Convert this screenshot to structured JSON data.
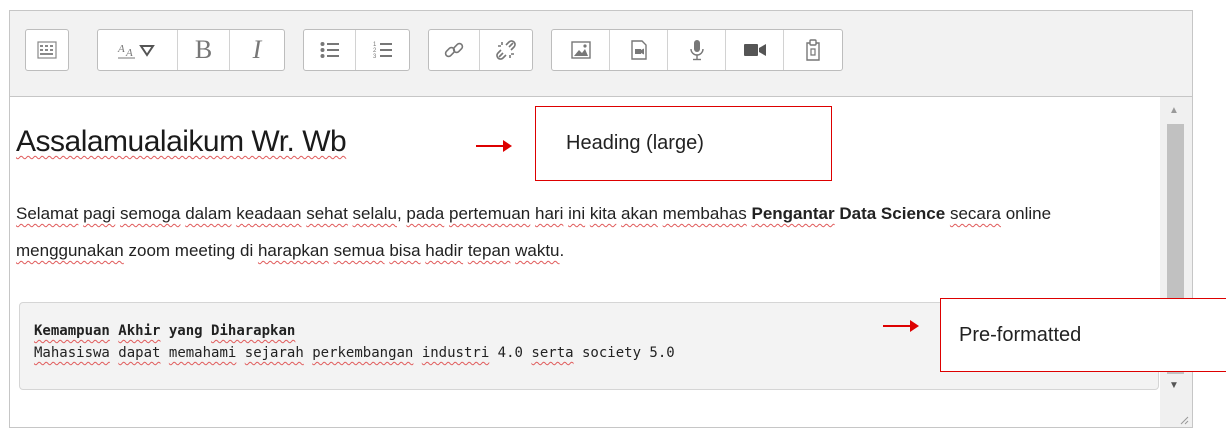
{
  "toolbar": {
    "buttons": [
      "toggle-toolbar",
      "paragraph-styles",
      "bold",
      "italic",
      "unordered-list",
      "ordered-list",
      "link",
      "unlink",
      "insert-image",
      "insert-media",
      "record-audio",
      "record-video",
      "manage-files"
    ],
    "bold_label": "B",
    "italic_label": "I"
  },
  "content": {
    "heading": "Assalamualaikum Wr. Wb",
    "paragraph": [
      {
        "t": "Selamat",
        "u": true
      },
      {
        "t": " "
      },
      {
        "t": "pagi",
        "u": true
      },
      {
        "t": " "
      },
      {
        "t": "semoga",
        "u": true
      },
      {
        "t": " "
      },
      {
        "t": "dalam",
        "u": true
      },
      {
        "t": " "
      },
      {
        "t": "keadaan",
        "u": true
      },
      {
        "t": " "
      },
      {
        "t": "sehat",
        "u": true
      },
      {
        "t": " "
      },
      {
        "t": "selalu",
        "u": true
      },
      {
        "t": ", "
      },
      {
        "t": "pada",
        "u": true
      },
      {
        "t": " "
      },
      {
        "t": "pertemuan",
        "u": true
      },
      {
        "t": " "
      },
      {
        "t": "hari",
        "u": true
      },
      {
        "t": " "
      },
      {
        "t": "ini",
        "u": true
      },
      {
        "t": " "
      },
      {
        "t": "kita",
        "u": true
      },
      {
        "t": " "
      },
      {
        "t": "akan",
        "u": true
      },
      {
        "t": " "
      },
      {
        "t": "membahas",
        "u": true
      },
      {
        "t": " "
      },
      {
        "t": "Pengantar",
        "u": true,
        "b": true
      },
      {
        "t": " Data Science",
        "b": true
      },
      {
        "t": " "
      },
      {
        "t": "secara",
        "u": true
      },
      {
        "t": " online "
      },
      {
        "t": "menggunakan",
        "u": true
      },
      {
        "t": " zoom meeting di "
      },
      {
        "t": "harapkan",
        "u": true
      },
      {
        "t": " "
      },
      {
        "t": "semua",
        "u": true
      },
      {
        "t": " "
      },
      {
        "t": "bisa",
        "u": true
      },
      {
        "t": " "
      },
      {
        "t": "hadir",
        "u": true
      },
      {
        "t": " "
      },
      {
        "t": "tepan",
        "u": true
      },
      {
        "t": " "
      },
      {
        "t": "waktu",
        "u": true
      },
      {
        "t": "."
      }
    ],
    "preformatted": [
      [
        {
          "t": "Kemampuan",
          "u": true,
          "b": true
        },
        {
          "t": " ",
          "b": true
        },
        {
          "t": "Akhir",
          "u": true,
          "b": true
        },
        {
          "t": " yang ",
          "b": true
        },
        {
          "t": "Diharapkan",
          "u": true,
          "b": true
        }
      ],
      [
        {
          "t": "Mahasiswa",
          "u": true
        },
        {
          "t": " "
        },
        {
          "t": "dapat",
          "u": true
        },
        {
          "t": " "
        },
        {
          "t": "memahami",
          "u": true
        },
        {
          "t": " "
        },
        {
          "t": "sejarah",
          "u": true
        },
        {
          "t": " "
        },
        {
          "t": "perkembangan",
          "u": true
        },
        {
          "t": " "
        },
        {
          "t": "industri",
          "u": true
        },
        {
          "t": " 4.0 "
        },
        {
          "t": "serta",
          "u": true
        },
        {
          "t": " society 5.0"
        }
      ]
    ]
  },
  "annotations": {
    "heading_callout": "Heading (large)",
    "pre_callout": "Pre-formatted"
  },
  "colors": {
    "annotation": "#dd0000",
    "spellcheck": "#e05a5a"
  }
}
